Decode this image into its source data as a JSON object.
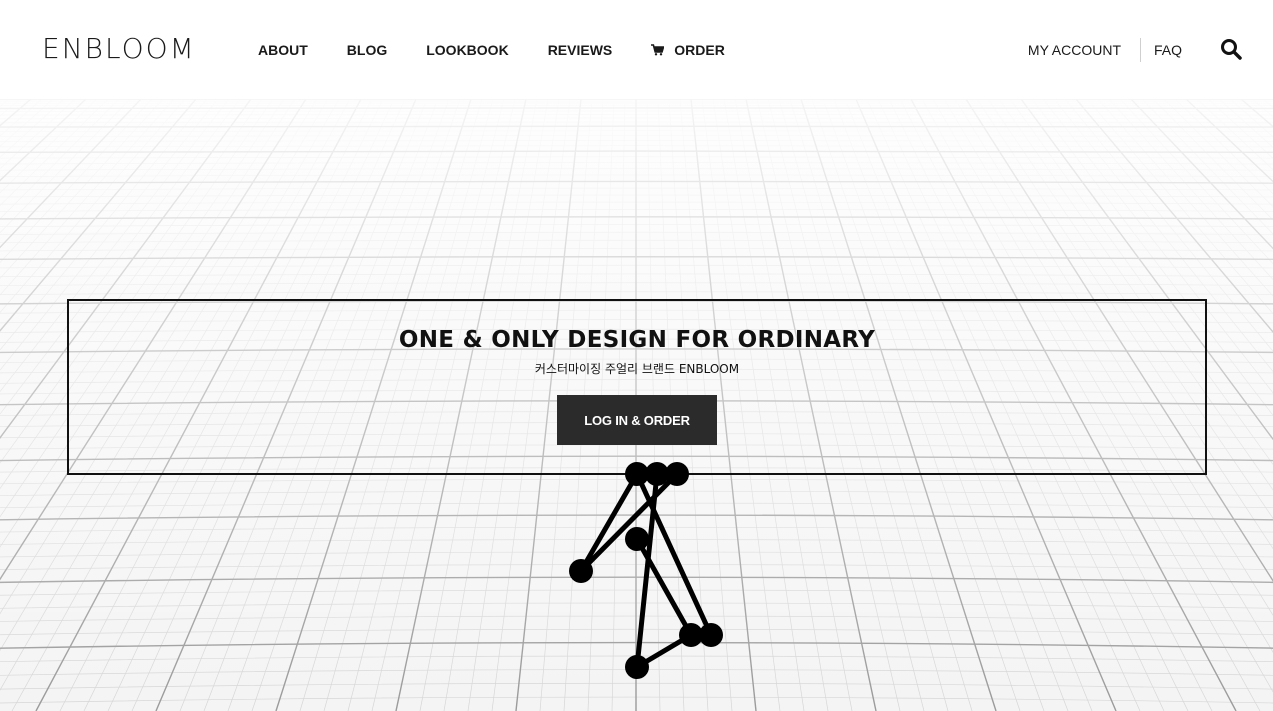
{
  "brand": {
    "logo_text": "ENBLOOM"
  },
  "nav": {
    "items": [
      {
        "label": "ABOUT"
      },
      {
        "label": "BLOG"
      },
      {
        "label": "LOOKBOOK"
      },
      {
        "label": "REVIEWS"
      },
      {
        "label": "ORDER",
        "icon": "cart-icon"
      }
    ]
  },
  "utility": {
    "account_label": "MY ACCOUNT",
    "faq_label": "FAQ",
    "search_icon": "search-icon"
  },
  "banner": {
    "title": "ONE & ONLY DESIGN FOR ORDINARY",
    "subtitle": "커스터마이징 주얼리 브랜드 ENBLOOM",
    "cta_label": "LOG IN & ORDER"
  },
  "colors": {
    "text": "#1a1a1a",
    "button_bg": "#2b2b2b",
    "button_text": "#ffffff",
    "hero_bg": "#f4f4f4"
  }
}
